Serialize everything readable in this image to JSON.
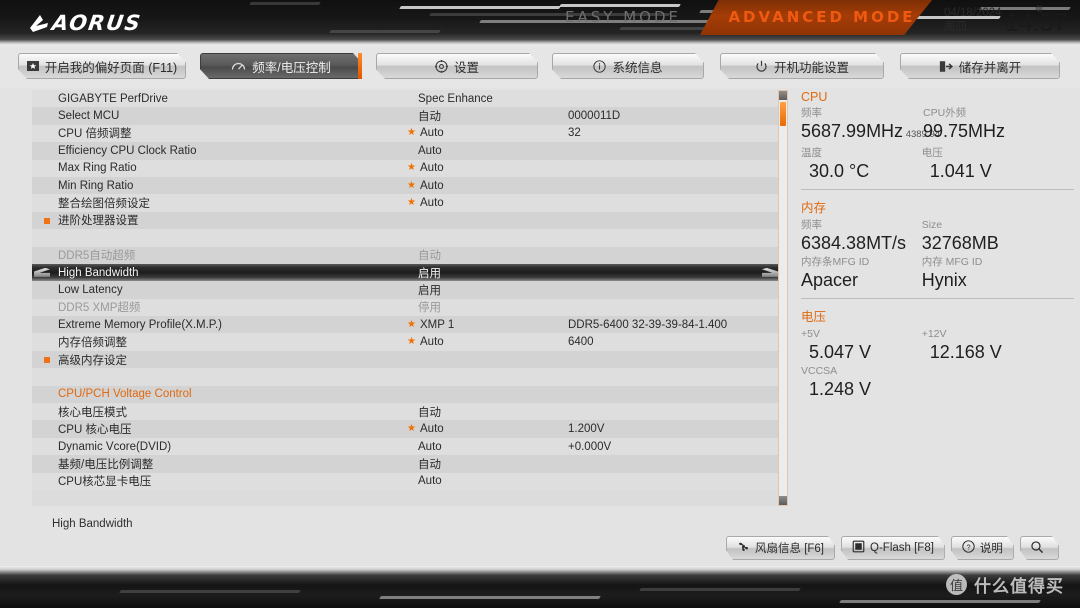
{
  "header": {
    "brand": "AORUS",
    "easy_mode": "EASY MODE",
    "advanced_mode": "ADVANCED MODE",
    "date": "04/18/2024",
    "weekday": "周四",
    "time": "14:57",
    "gear_icon": "gear-icon"
  },
  "nav": {
    "tabs": [
      {
        "label": "开启我的偏好页面 (F11)",
        "icon": "star-box-icon",
        "active": false
      },
      {
        "label": "频率/电压控制",
        "icon": "gauge-icon",
        "active": true
      },
      {
        "label": "设置",
        "icon": "gear-icon",
        "active": false
      },
      {
        "label": "系统信息",
        "icon": "info-icon",
        "active": false
      },
      {
        "label": "开机功能设置",
        "icon": "power-icon",
        "active": false
      },
      {
        "label": "储存并离开",
        "icon": "exit-icon",
        "active": false
      }
    ]
  },
  "settings_rows": [
    {
      "label": "GIGABYTE PerfDrive",
      "value": "Spec Enhance",
      "extra": "",
      "star": false,
      "style": "normal"
    },
    {
      "label": "Select MCU",
      "value": "自动",
      "extra": "0000011D",
      "star": false,
      "style": "normal"
    },
    {
      "label": "CPU 倍频调整",
      "value": "Auto",
      "extra": "32",
      "star": true,
      "style": "normal"
    },
    {
      "label": "Efficiency CPU Clock Ratio",
      "value": "Auto",
      "extra": "",
      "star": false,
      "style": "normal"
    },
    {
      "label": "Max Ring Ratio",
      "value": "Auto",
      "extra": "",
      "star": true,
      "style": "normal"
    },
    {
      "label": "Min Ring Ratio",
      "value": "Auto",
      "extra": "",
      "star": true,
      "style": "normal"
    },
    {
      "label": "整合绘图倍频设定",
      "value": "Auto",
      "extra": "",
      "star": true,
      "style": "normal"
    },
    {
      "label": "进阶处理器设置",
      "value": "",
      "extra": "",
      "star": false,
      "style": "submenu"
    },
    {
      "label": "",
      "value": "",
      "extra": "",
      "star": false,
      "style": "blank"
    },
    {
      "label": "DDR5自动超频",
      "value": "自动",
      "extra": "",
      "star": false,
      "style": "dim"
    },
    {
      "label": "High Bandwidth",
      "value": "启用",
      "extra": "",
      "star": false,
      "style": "selected"
    },
    {
      "label": "Low Latency",
      "value": "启用",
      "extra": "",
      "star": false,
      "style": "normal"
    },
    {
      "label": "DDR5 XMP超频",
      "value": "停用",
      "extra": "",
      "star": false,
      "style": "dim"
    },
    {
      "label": "Extreme Memory Profile(X.M.P.)",
      "value": "XMP 1",
      "extra": "DDR5-6400 32-39-39-84-1.400",
      "star": true,
      "style": "normal"
    },
    {
      "label": "内存倍频调整",
      "value": "Auto",
      "extra": "6400",
      "star": true,
      "style": "normal"
    },
    {
      "label": "高级内存设定",
      "value": "",
      "extra": "",
      "star": false,
      "style": "submenu"
    },
    {
      "label": "",
      "value": "",
      "extra": "",
      "star": false,
      "style": "blank"
    },
    {
      "label": "CPU/PCH Voltage Control",
      "value": "",
      "extra": "",
      "star": false,
      "style": "section"
    },
    {
      "label": "核心电压模式",
      "value": "自动",
      "extra": "",
      "star": false,
      "style": "normal"
    },
    {
      "label": "CPU 核心电压",
      "value": "Auto",
      "extra": "1.200V",
      "star": true,
      "style": "normal"
    },
    {
      "label": "Dynamic Vcore(DVID)",
      "value": "Auto",
      "extra": "+0.000V",
      "star": false,
      "style": "normal"
    },
    {
      "label": "基频/电压比例调整",
      "value": "自动",
      "extra": "",
      "star": false,
      "style": "normal"
    },
    {
      "label": "CPU核芯显卡电压",
      "value": "Auto",
      "extra": "",
      "star": false,
      "style": "normal"
    }
  ],
  "sidebar": {
    "groups": [
      {
        "title": "CPU",
        "rows": [
          [
            {
              "key": "频率",
              "value": "5687.99MHz",
              "sub": "4389.94"
            },
            {
              "key": "CPU外频",
              "value": "99.75MHz",
              "sub": ""
            }
          ],
          [
            {
              "key": "温度",
              "value": "30.0 °C",
              "sub": "",
              "indent": true
            },
            {
              "key": "电压",
              "value": "1.041 V",
              "sub": "",
              "indent": true
            }
          ]
        ]
      },
      {
        "title": "内存",
        "rows": [
          [
            {
              "key": "频率",
              "value": "6384.38MT/s",
              "sub": ""
            },
            {
              "key": "Size",
              "value": "32768MB",
              "sub": ""
            }
          ],
          [
            {
              "key": "内存条MFG ID",
              "value": "Apacer",
              "sub": ""
            },
            {
              "key": "内存 MFG ID",
              "value": "Hynix",
              "sub": ""
            }
          ]
        ]
      },
      {
        "title": "电压",
        "rows": [
          [
            {
              "key": "+5V",
              "value": "5.047 V",
              "sub": "",
              "indent": true
            },
            {
              "key": "+12V",
              "value": "12.168 V",
              "sub": "",
              "indent": true
            }
          ],
          [
            {
              "key": "VCCSA",
              "value": "1.248 V",
              "sub": "",
              "indent": true
            },
            {
              "key": "",
              "value": "",
              "sub": ""
            }
          ]
        ]
      }
    ]
  },
  "footer": {
    "status": "High Bandwidth",
    "buttons": [
      {
        "label": "风扇信息 [F6]",
        "icon": "fan-icon"
      },
      {
        "label": "Q-Flash [F8]",
        "icon": "flash-icon"
      },
      {
        "label": "说明",
        "icon": "question-icon"
      },
      {
        "label": "",
        "icon": "search-icon"
      }
    ]
  },
  "watermark": {
    "mark": "值",
    "text": "什么值得买"
  },
  "colors": {
    "accent": "#e06a10",
    "star": "#f07000",
    "advanced_mode": "#f05a10"
  }
}
